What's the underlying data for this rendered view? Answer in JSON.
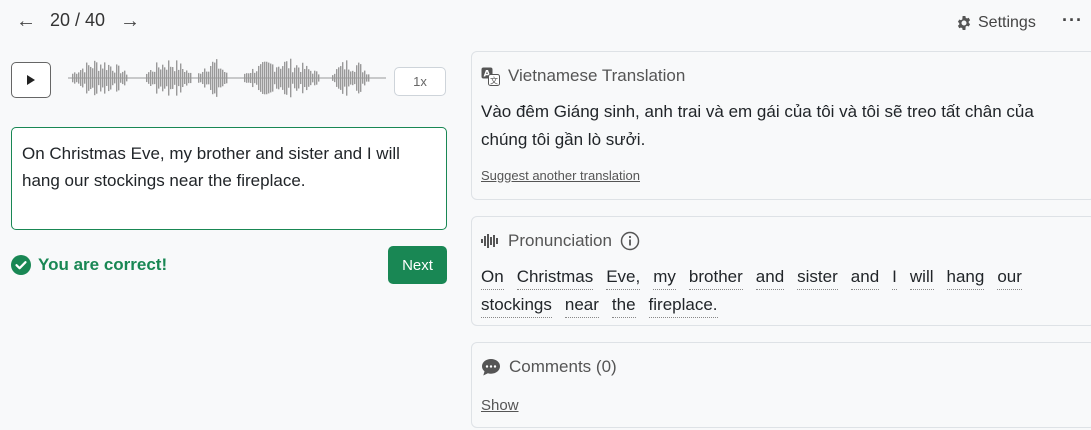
{
  "nav": {
    "prev_arrow": "←",
    "next_arrow": "→",
    "counter": "20 / 40",
    "settings_label": "Settings",
    "more": "···"
  },
  "player": {
    "speed": "1x"
  },
  "answer": {
    "text": "On Christmas Eve, my brother and sister and I will hang our stockings near the fireplace."
  },
  "feedback": {
    "message": "You are correct!",
    "next_label": "Next"
  },
  "translation": {
    "title": "Vietnamese Translation",
    "text": "Vào đêm Giáng sinh, anh trai và em gái của tôi và tôi sẽ treo tất chân của chúng tôi gần lò sưởi.",
    "suggest_link": "Suggest another translation"
  },
  "pronunciation": {
    "title": "Pronunciation",
    "words": [
      "On",
      "Christmas",
      "Eve,",
      "my",
      "brother",
      "and",
      "sister",
      "and",
      "I",
      "will",
      "hang",
      "our",
      "stockings",
      "near",
      "the",
      "fireplace."
    ]
  },
  "comments": {
    "title": "Comments (0)",
    "show_link": "Show"
  },
  "colors": {
    "accent": "#198754",
    "background": "#f8f9fa"
  }
}
